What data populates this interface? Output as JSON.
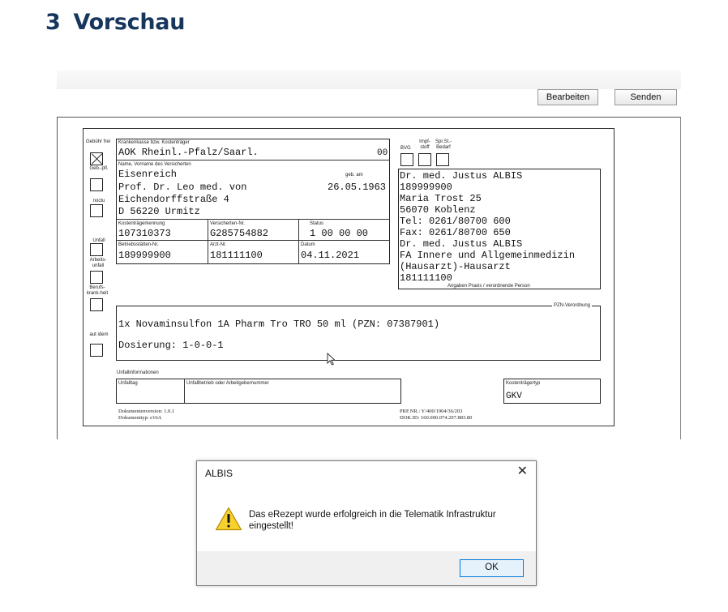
{
  "heading": {
    "number": "3",
    "title": "Vorschau"
  },
  "toolbar": {
    "edit_label": "Bearbeiten",
    "send_label": "Senden"
  },
  "form": {
    "left_labels": {
      "gebuehr_frei": "Gebühr frei",
      "geb_pfl": "Geb.-pfl.",
      "noctu": "noctu",
      "unfall": "Unfall",
      "arbeitsunfall": "Arbeits-unfall",
      "berufskrankheit": "Berufs-krank-heit",
      "aut_idem": "aut idem"
    },
    "kasse_label": "Krankenkasse bzw. Kostenträger",
    "kasse_value": "AOK Rheinl.-Pfalz/Saarl.",
    "kasse_code": "00",
    "name_label": "Name, Vorname des Versicherten",
    "name_line1": "Eisenreich",
    "name_line2": "Prof. Dr. Leo med. von",
    "geb_label": "geb. am",
    "geb_value": "26.05.1963",
    "street": "Eichendorffstraße 4",
    "city": "D 56220 Urmitz",
    "kt_kennung_label": "Kostenträgerkennung",
    "kt_kennung_value": "107310373",
    "vers_nr_label": "Versicherten-Nr.",
    "vers_nr_value": "G285754882",
    "status_label": "Status",
    "status_value": "1 00 00 00",
    "bsnr_label": "Betriebsstätten-Nr.",
    "bsnr_value": "189999900",
    "arzt_nr_label": "Arzt-Nr.",
    "arzt_nr_value": "181111100",
    "datum_label": "Datum",
    "datum_value": "04.11.2021",
    "top_right_labels": {
      "bvg": "BVG",
      "impfstoff": "Impf-stoff",
      "spr": "Spr.St.-Bedarf"
    },
    "praxis_lines": [
      "Dr. med. Justus ALBIS",
      "189999900",
      "Maria Trost  25",
      "56070 Koblenz",
      "Tel: 0261/80700 600",
      "Fax: 0261/80700 650",
      "Dr. med. Justus ALBIS",
      "FA Innere und Allgemeinmedizin",
      "(Hausarzt)-Hausarzt",
      "181111100"
    ],
    "praxis_caption": "Angaben Praxis / verordnende Person",
    "pzn_label": "PZN-Verordnung",
    "verordnung_line": "1x Novaminsulfon 1A Pharm Tro TRO 50 ml (PZN: 07387901)",
    "dosierung_line": "Dosierung: 1-0-0-1",
    "unfallinfo_label": "Unfallinformationen",
    "unfalltag_label": "Unfalltag",
    "unfallbetrieb_label": "Unfallbetrieb oder Arbeitgebernummer",
    "kostentraegertyp_label": "Kostenträgertyp",
    "kostentraegertyp_value": "GKV",
    "footer_left_1": "Dokumentenversion: 1.0.1",
    "footer_left_2": "Dokumenttyp: e16A",
    "footer_right_1": "PRF.NR.: Y/400/1904/36/203",
    "footer_right_2": "DOK.ID: 160.000.074.297.883.80"
  },
  "dialog": {
    "title": "ALBIS",
    "close": "✕",
    "message": "Das eRezept wurde erfolgreich in die Telematik Infrastruktur eingestellt!",
    "ok_label": "OK"
  }
}
